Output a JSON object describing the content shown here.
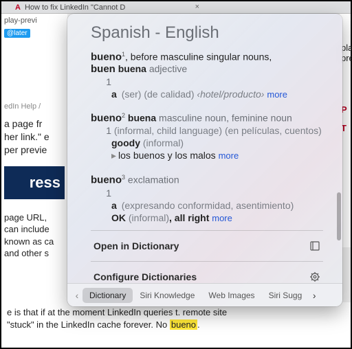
{
  "browser_tab": {
    "favicon": "A",
    "title": "How to fix LinkedIn \"Cannot D",
    "close": "×"
  },
  "background": {
    "url_fragment": "play-previ",
    "handle": "@later",
    "breadcrumb": "edIn Help  /",
    "para1_l1": "a page fr",
    "para1_l2": "her link.\" e",
    "para1_l3": "per previe",
    "logo_fragment": "ress",
    "bottom_lines": [
      "page URL,",
      "can include",
      "known as ca",
      "and other s"
    ],
    "right_p": "P",
    "right_t": "T",
    "final_l4": "e is that if at the moment LinkedIn queries t.   remote site",
    "final_l5_pre": "\"stuck\" in the LinkedIn cache forever. No ",
    "highlighted_word": "bueno",
    "final_l5_post": "."
  },
  "popover": {
    "title": "Spanish - English",
    "entries": [
      {
        "head": "bueno",
        "sup": "1",
        "rest": ", before masculine singular nouns,",
        "line2_a": "buen",
        "line2_b": "buena",
        "line2_pos": "adjective",
        "sense_n": "1",
        "sub": "a",
        "paren": "(ser) (de calidad)",
        "angle": "‹hotel/producto›",
        "more": "more"
      },
      {
        "head": "bueno",
        "sup": "2",
        "var": "buena",
        "pos": "masculine noun, feminine noun",
        "sense_n": "1",
        "paren1": "(informal, child language) (en películas, cuentos)",
        "gloss": "goody",
        "paren2": "(informal)",
        "ex": "los buenos y los malos",
        "more": "more"
      },
      {
        "head": "bueno",
        "sup": "3",
        "pos": "exclamation",
        "sense_n": "1",
        "sub": "a",
        "paren": "(expresando conformidad, asentimiento)",
        "gloss1": "OK",
        "paren2": "(informal)",
        "gloss2": ", all right",
        "more": "more"
      }
    ],
    "actions": {
      "open": "Open in Dictionary",
      "configure": "Configure Dictionaries"
    },
    "tabs": [
      "Dictionary",
      "Siri Knowledge",
      "Web Images",
      "Siri Sugg"
    ]
  }
}
